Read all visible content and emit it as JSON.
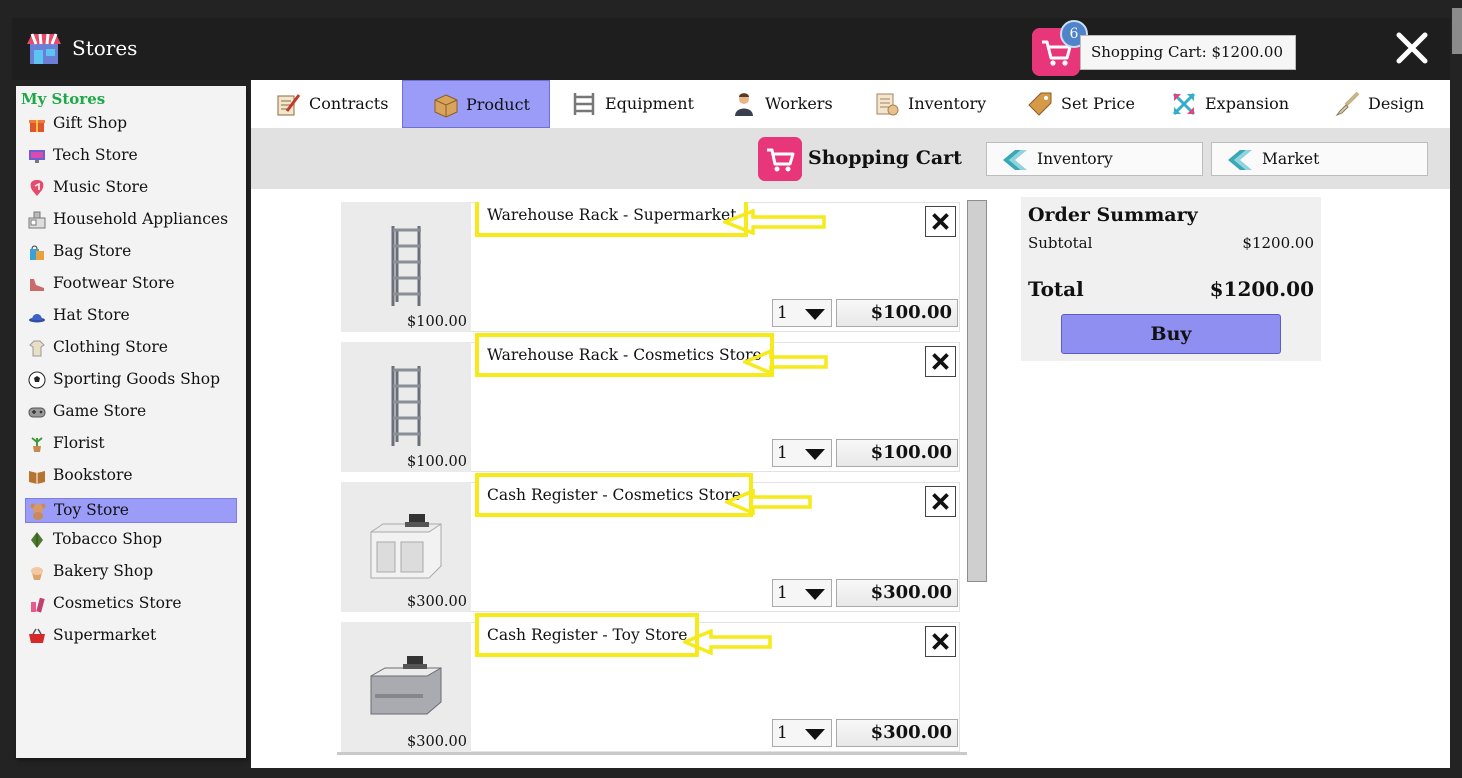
{
  "window": {
    "title": "Stores"
  },
  "cart_header": {
    "badge_count": "6",
    "summary_label": "Shopping Cart: $1200.00"
  },
  "sidebar": {
    "title": "My Stores",
    "items": [
      {
        "label": "Gift Shop",
        "icon": "gift-icon"
      },
      {
        "label": "Tech Store",
        "icon": "monitor-icon"
      },
      {
        "label": "Music Store",
        "icon": "guitar-pick-icon"
      },
      {
        "label": "Household Appliances",
        "icon": "appliance-icon"
      },
      {
        "label": "Bag Store",
        "icon": "bag-icon"
      },
      {
        "label": "Footwear Store",
        "icon": "shoe-icon"
      },
      {
        "label": "Hat Store",
        "icon": "hat-icon"
      },
      {
        "label": "Clothing Store",
        "icon": "shirt-icon"
      },
      {
        "label": "Sporting Goods Shop",
        "icon": "soccer-ball-icon"
      },
      {
        "label": "Game Store",
        "icon": "gamepad-icon"
      },
      {
        "label": "Florist",
        "icon": "plant-icon"
      },
      {
        "label": "Bookstore",
        "icon": "book-icon"
      },
      {
        "label": "Toy Store",
        "icon": "teddy-bear-icon",
        "selected": true
      },
      {
        "label": "Tobacco Shop",
        "icon": "leaf-icon"
      },
      {
        "label": "Bakery Shop",
        "icon": "cupcake-icon"
      },
      {
        "label": "Cosmetics Store",
        "icon": "cosmetics-icon"
      },
      {
        "label": "Supermarket",
        "icon": "basket-icon"
      }
    ]
  },
  "tabs": [
    {
      "label": "Contracts",
      "icon": "contract-pen-icon"
    },
    {
      "label": "Product",
      "icon": "box-icon",
      "active": true
    },
    {
      "label": "Equipment",
      "icon": "shelf-icon"
    },
    {
      "label": "Workers",
      "icon": "worker-icon"
    },
    {
      "label": "Inventory",
      "icon": "inventory-list-icon"
    },
    {
      "label": "Set Price",
      "icon": "price-tag-icon"
    },
    {
      "label": "Expansion",
      "icon": "expand-arrows-icon"
    },
    {
      "label": "Design",
      "icon": "paint-brush-icon"
    }
  ],
  "subbar": {
    "title": "Shopping Cart",
    "nav_buttons": [
      {
        "label": "Inventory"
      },
      {
        "label": "Market"
      }
    ]
  },
  "cart_items": [
    {
      "name": "Warehouse Rack - Supermarket",
      "thumb_price": "$100.00",
      "qty": "1",
      "line_price": "$100.00",
      "image": "warehouse-rack"
    },
    {
      "name": "Warehouse Rack - Cosmetics Store",
      "thumb_price": "$100.00",
      "qty": "1",
      "line_price": "$100.00",
      "image": "warehouse-rack"
    },
    {
      "name": "Cash Register - Cosmetics Store",
      "thumb_price": "$300.00",
      "qty": "1",
      "line_price": "$300.00",
      "image": "cash-register-white"
    },
    {
      "name": "Cash Register - Toy Store",
      "thumb_price": "$300.00",
      "qty": "1",
      "line_price": "$300.00",
      "image": "cash-register-grey"
    }
  ],
  "order_summary": {
    "title": "Order Summary",
    "subtotal_label": "Subtotal",
    "subtotal_value": "$1200.00",
    "total_label": "Total",
    "total_value": "$1200.00",
    "buy_label": "Buy"
  },
  "colors": {
    "accent": "#9b9cf7",
    "my_stores_green": "#1fa847",
    "highlight_yellow": "#f6ea1a",
    "cart_pink": "#e0246b",
    "badge_blue": "#4f84c9"
  }
}
